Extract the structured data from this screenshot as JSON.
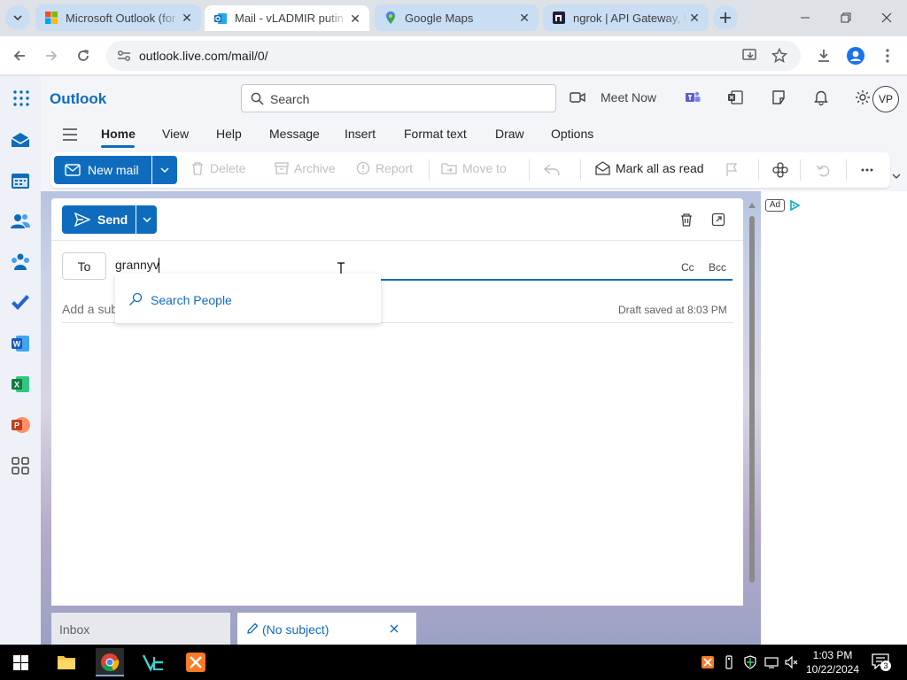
{
  "browser": {
    "tabs": [
      {
        "title": "Microsoft Outlook (for",
        "favicon": "microsoft-icon",
        "active": false
      },
      {
        "title": "Mail - vLADMIR putin",
        "favicon": "outlook-icon",
        "active": true
      },
      {
        "title": "Google Maps",
        "favicon": "google-maps-icon",
        "active": false
      },
      {
        "title": "ngrok | API Gateway, I",
        "favicon": "ngrok-icon",
        "active": false
      }
    ],
    "url": "outlook.live.com/mail/0/"
  },
  "outlook": {
    "brand": "Outlook",
    "search_placeholder": "Search",
    "meet_now": "Meet Now",
    "avatar_initials": "VP",
    "menu_tabs": [
      "Home",
      "View",
      "Help",
      "Message",
      "Insert",
      "Format text",
      "Draw",
      "Options"
    ],
    "active_tab": "Home",
    "commands": {
      "new_mail": "New mail",
      "delete": "Delete",
      "archive": "Archive",
      "report": "Report",
      "move_to": "Move to",
      "mark_all_read": "Mark all as read"
    },
    "compose": {
      "send": "Send",
      "to_label": "To",
      "to_value": "grannyv",
      "cc": "Cc",
      "bcc": "Bcc",
      "subject_placeholder": "Add a subject",
      "draft_status": "Draft saved at 8:03 PM",
      "suggestion": "Search People"
    },
    "ad_label": "Ad",
    "bottom_tabs": {
      "inbox": "Inbox",
      "draft": "(No subject)"
    }
  },
  "taskbar": {
    "time": "1:03 PM",
    "date": "10/22/2024",
    "notification_count": "3"
  }
}
